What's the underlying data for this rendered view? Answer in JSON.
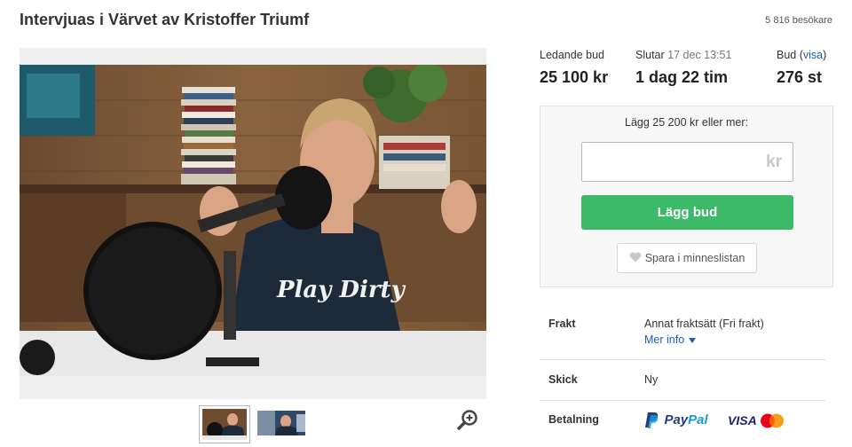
{
  "header": {
    "title": "Intervjuas i Värvet av Kristoffer Triumf",
    "visitors": "5 816 besökare"
  },
  "stats": {
    "leading_bid_label": "Ledande bud",
    "leading_bid_value": "25 100 kr",
    "ends_label": "Slutar",
    "ends_date": "17 dec 13:51",
    "ends_value": "1 dag 22 tim",
    "bids_label": "Bud",
    "bids_link_open": "(",
    "bids_link": "visa",
    "bids_link_close": ")",
    "bids_value": "276 st"
  },
  "bid_form": {
    "hint": "Lägg 25 200 kr eller mer:",
    "input_value": "",
    "unit": "kr",
    "submit_label": "Lägg bud",
    "save_label": "Spara i minneslistan"
  },
  "details": {
    "shipping_key": "Frakt",
    "shipping_value": "Annat fraktsätt (Fri frakt)",
    "more_info": "Mer info",
    "condition_key": "Skick",
    "condition_value": "Ny",
    "payment_key": "Betalning",
    "payment_paypal_a": "Pay",
    "payment_paypal_b": "Pal",
    "payment_visa": "VISA"
  },
  "photo": {
    "hoodie_text": "Play Dirty"
  },
  "icons": {
    "zoom": "zoom-in-icon",
    "heart": "heart-icon",
    "chevron": "triangle-down-icon"
  },
  "colors": {
    "accent_green": "#3cba6a",
    "link_blue": "#1a5fb4"
  }
}
